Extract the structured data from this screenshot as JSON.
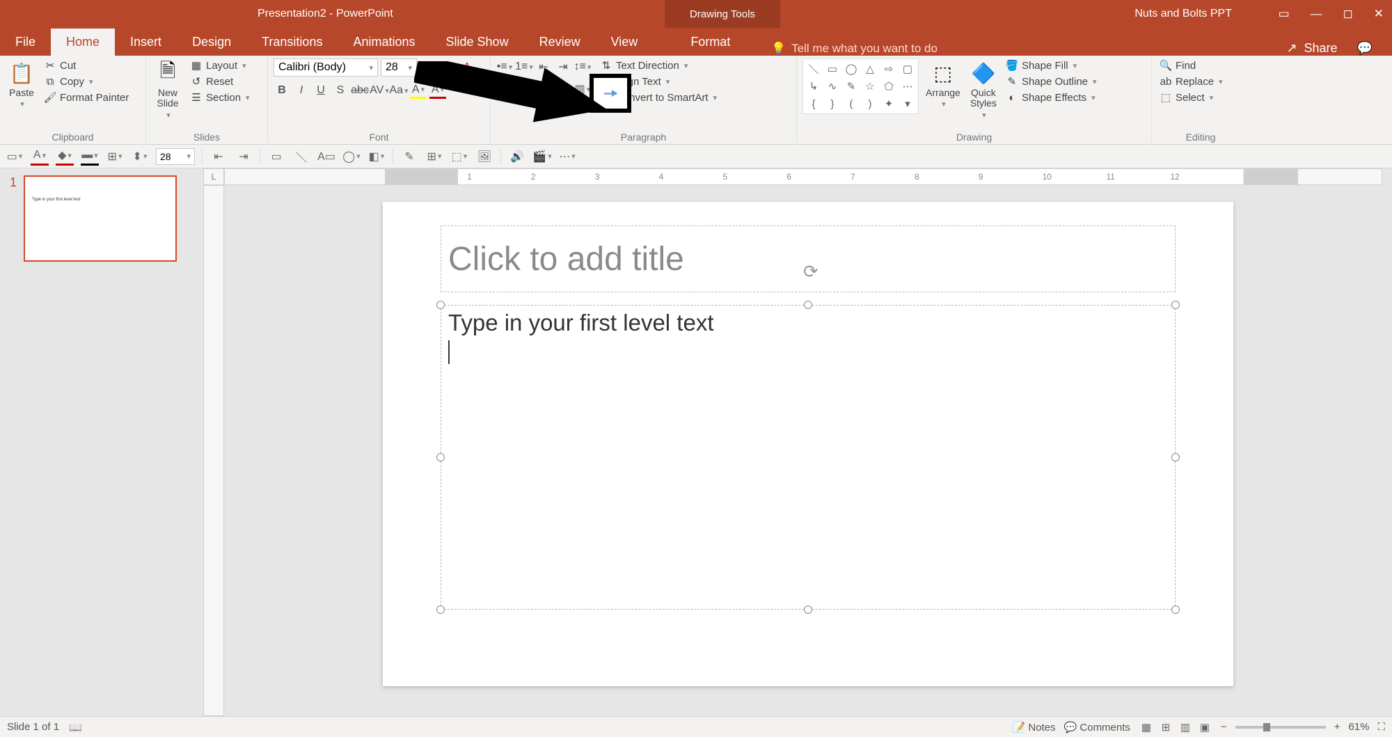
{
  "titlebar": {
    "doc_title": "Presentation2  -  PowerPoint",
    "tools": "Drawing Tools",
    "account": "Nuts and Bolts PPT"
  },
  "tabs": {
    "file": "File",
    "home": "Home",
    "insert": "Insert",
    "design": "Design",
    "transitions": "Transitions",
    "animations": "Animations",
    "slideshow": "Slide Show",
    "review": "Review",
    "view": "View",
    "format": "Format",
    "tellme": "Tell me what you want to do",
    "share": "Share"
  },
  "ribbon": {
    "clipboard": {
      "label": "Clipboard",
      "paste": "Paste",
      "cut": "Cut",
      "copy": "Copy",
      "format_painter": "Format Painter"
    },
    "slides": {
      "label": "Slides",
      "new_slide": "New\nSlide",
      "layout": "Layout",
      "reset": "Reset",
      "section": "Section"
    },
    "font": {
      "label": "Font",
      "name": "Calibri (Body)",
      "size": "28"
    },
    "paragraph": {
      "label": "Paragraph",
      "text_dir": "Text Direction",
      "align_text": "Align Text",
      "smartart": "Convert to SmartArt"
    },
    "drawing": {
      "label": "Drawing",
      "arrange": "Arrange",
      "quick_styles": "Quick\nStyles",
      "shape_fill": "Shape Fill",
      "shape_outline": "Shape Outline",
      "shape_effects": "Shape Effects"
    },
    "editing": {
      "label": "Editing",
      "find": "Find",
      "replace": "Replace",
      "select": "Select"
    }
  },
  "qat": {
    "size": "28"
  },
  "slide": {
    "num": "1",
    "thumb_text": "Type in your first level text",
    "title_placeholder": "Click to add title",
    "body_text": "Type in your first level text"
  },
  "ruler": {
    "t1": "1",
    "t2": "2",
    "t3": "3",
    "t4": "4",
    "t5": "5",
    "t6": "6",
    "t7": "7",
    "t8": "8",
    "t9": "9",
    "t10": "10",
    "t11": "11",
    "t12": "12"
  },
  "status": {
    "slide": "Slide 1 of 1",
    "notes": "Notes",
    "comments": "Comments",
    "zoom": "61%"
  }
}
